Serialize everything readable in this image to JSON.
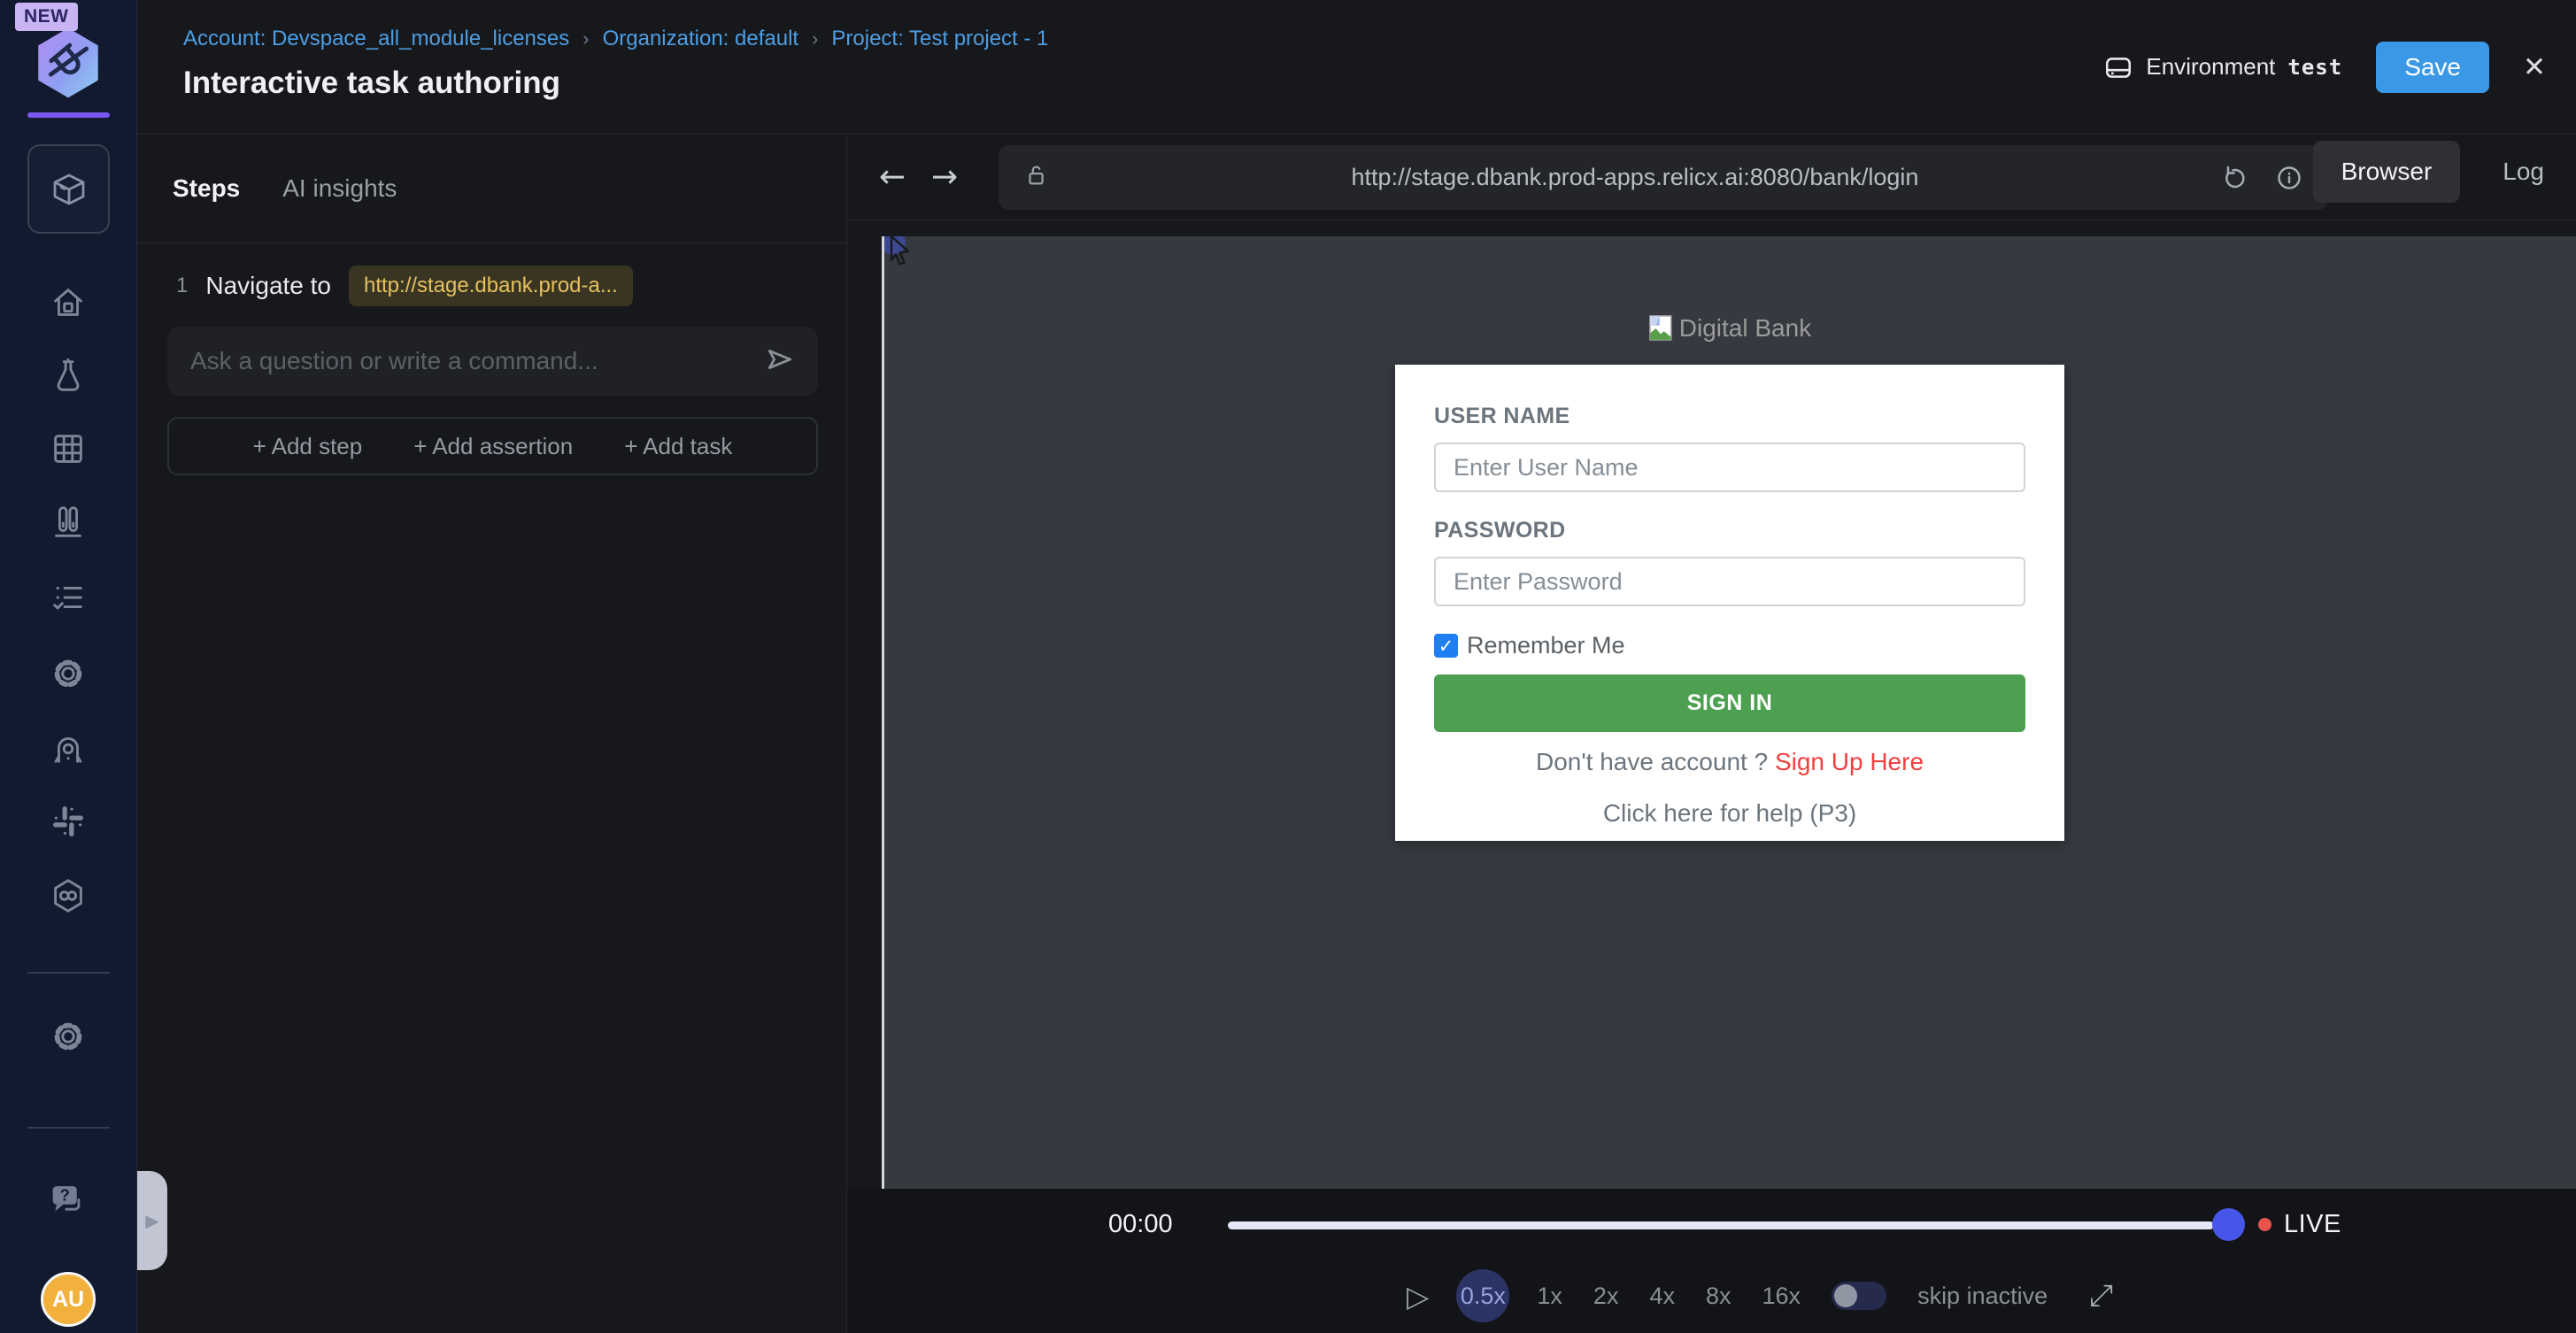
{
  "sidebar": {
    "new_badge": "NEW",
    "avatar_initials": "AU"
  },
  "header": {
    "breadcrumb": [
      {
        "label": "Account: Devspace_all_module_licenses"
      },
      {
        "label": "Organization: default"
      },
      {
        "label": "Project: Test project - 1"
      }
    ],
    "breadcrumb_separator": "›",
    "title": "Interactive task authoring",
    "environment_label": "Environment",
    "environment_value": "test",
    "save_label": "Save"
  },
  "steps_panel": {
    "tabs": [
      {
        "label": "Steps"
      },
      {
        "label": "AI insights"
      }
    ],
    "step": {
      "index": "1",
      "action": "Navigate to",
      "target": "http://stage.dbank.prod-a..."
    },
    "command_input_placeholder": "Ask a question or write a command...",
    "actions": [
      {
        "label": "+ Add step"
      },
      {
        "label": "+ Add assertion"
      },
      {
        "label": "+ Add task"
      }
    ]
  },
  "browser_panel": {
    "url": "http://stage.dbank.prod-apps.relicx.ai:8080/bank/login",
    "tabs": [
      {
        "label": "Browser"
      },
      {
        "label": "Log"
      }
    ]
  },
  "login_page": {
    "logo_alt": "Digital Bank",
    "username_label": "USER NAME",
    "username_placeholder": "Enter User Name",
    "password_label": "PASSWORD",
    "password_placeholder": "Enter Password",
    "remember_label": "Remember Me",
    "remember_checked": true,
    "signin_label": "SIGN IN",
    "signup_prompt": "Don't have account ?",
    "signup_link": "Sign Up Here",
    "help_text": "Click here for help (P3)"
  },
  "player": {
    "elapsed": "00:00",
    "live_label": "LIVE",
    "speeds": [
      "0.5x",
      "1x",
      "2x",
      "4x",
      "8x",
      "16x"
    ],
    "active_speed": "0.5x",
    "skip_inactive_label": "skip inactive"
  },
  "icons": {
    "back": "←",
    "forward": "→",
    "close": "✕",
    "play": "▷",
    "expand": "⤢",
    "check": "✓",
    "handle": "▶"
  },
  "colors": {
    "accent_blue": "#3b98e6",
    "breadcrumb_blue": "#4d9ee5",
    "chip_yellow": "#e5c15d",
    "signin_green": "#4ca050",
    "signup_red": "#f23f3f",
    "checkbox_blue": "#1f7ff2",
    "avatar_yellow": "#f2b13c",
    "live_red": "#e8544c",
    "thumb_blue": "#4656e8",
    "logo_purple": "#7a57f0",
    "sidebar_navy": "#111a2e",
    "panel_dark": "#17181b",
    "viewport_slate": "#363a40"
  }
}
